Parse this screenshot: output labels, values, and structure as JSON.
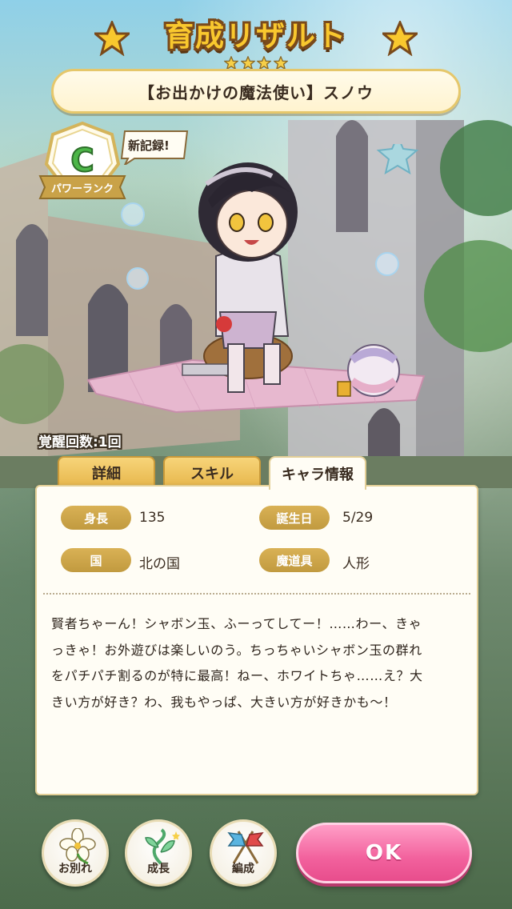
{
  "header": {
    "title": "育成リザルト",
    "rarity_stars": 4,
    "card_name": "【お出かけの魔法使い】スノウ"
  },
  "rank": {
    "grade": "C",
    "label": "パワーランク",
    "new_record": "新記録!"
  },
  "awakening": "覚醒回数:1回",
  "tabs": [
    {
      "label": "詳細",
      "active": false
    },
    {
      "label": "スキル",
      "active": false
    },
    {
      "label": "キャラ情報",
      "active": true
    }
  ],
  "profile": {
    "height_label": "身長",
    "height_value": "135",
    "birthday_label": "誕生日",
    "birthday_value": "5/29",
    "country_label": "国",
    "country_value": "北の国",
    "tool_label": "魔道具",
    "tool_value": "人形"
  },
  "description": [
    "賢者ちゃーん！シャボン玉、ふーってしてー！……わー、きゃ",
    "っきゃ！お外遊びは楽しいのう。ちっちゃいシャボン玉の群れ",
    "をパチパチ割るのが特に最高！ねー、ホワイトちゃ……え？大",
    "きい方が好き？わ、我もやっぱ、大きい方が好きかも～！"
  ],
  "buttons": {
    "farewell": "お別れ",
    "growth": "成長",
    "formation": "編成",
    "ok": "OK"
  },
  "colors": {
    "title_fill": "#f9c82e",
    "label_pill": "#c9a248",
    "ok_pink": "#f2619d",
    "rank_green": "#4cb648"
  }
}
